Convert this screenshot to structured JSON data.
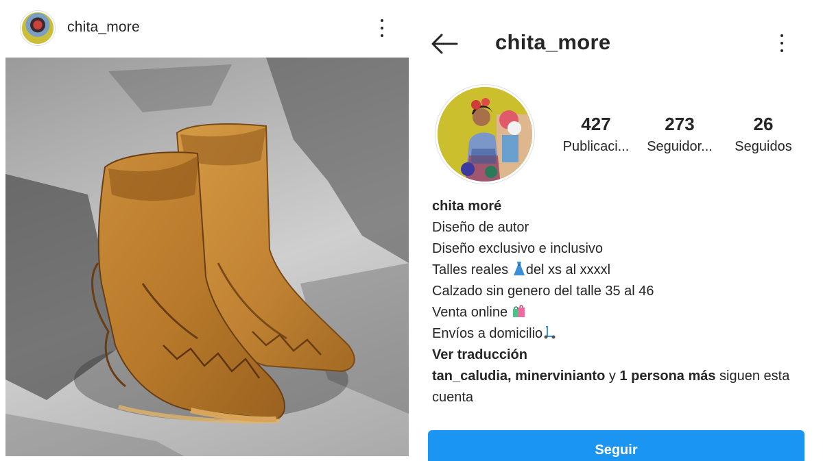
{
  "post": {
    "username": "chita_more"
  },
  "profile": {
    "title": "chita_more",
    "stats": [
      {
        "count": "427",
        "label": "Publicaci..."
      },
      {
        "count": "273",
        "label": "Seguidor..."
      },
      {
        "count": "26",
        "label": "Seguidos"
      }
    ],
    "bio": {
      "name": "chita moré",
      "lines": [
        "Diseño de autor",
        "Diseño exclusivo e inclusivo",
        "Talles reales",
        "del xs al xxxxl",
        "Calzado sin genero del talle 35 al 46",
        "Venta online",
        "Envíos a domicilio"
      ],
      "translate": "Ver traducción",
      "followed_by": {
        "names": "tan_caludia, minervinianto",
        "connector": " y ",
        "others": "1 persona más",
        "suffix": " siguen esta cuenta"
      }
    },
    "follow_button": "Seguir"
  },
  "icons": {
    "back": "arrow-left-icon",
    "more": "more-vertical-icon",
    "dress": "dress-emoji",
    "shopping": "shopping-bags-emoji",
    "scooter": "kick-scooter-emoji"
  },
  "colors": {
    "accent": "#1a95f1",
    "text": "#262626"
  }
}
